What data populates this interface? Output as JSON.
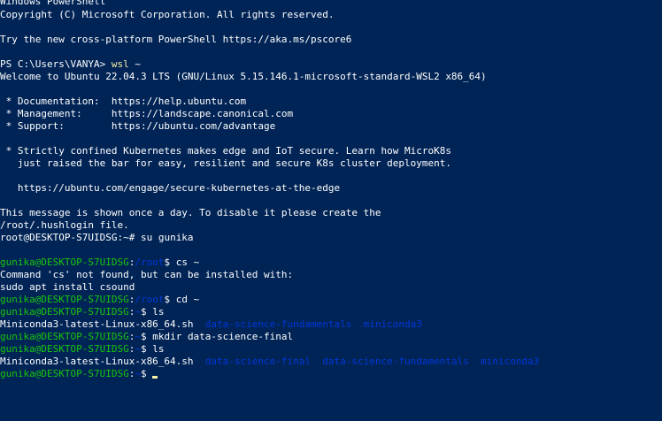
{
  "terminal": {
    "colors": {
      "background": "#012456",
      "text": "#ffffff",
      "user_host": "#16c60c",
      "path": "#0037da",
      "command_highlight": "#f9f1a5"
    },
    "header": {
      "title_line": "Windows PowerShell",
      "copyright": "Copyright (C) Microsoft Corporation. All rights reserved.",
      "tip": "Try the new cross-platform PowerShell https://aka.ms/pscore6"
    },
    "ps_prompt": {
      "prompt": "PS C:\\Users\\VANYA> ",
      "command": "wsl",
      "args": " ~"
    },
    "motd": {
      "welcome": "Welcome to Ubuntu 22.04.3 LTS (GNU/Linux 5.15.146.1-microsoft-standard-WSL2 x86_64)",
      "documentation": " * Documentation:  https://help.ubuntu.com",
      "management": " * Management:     https://landscape.canonical.com",
      "support": " * Support:        https://ubuntu.com/advantage",
      "k8s_line1": " * Strictly confined Kubernetes makes edge and IoT secure. Learn how MicroK8s",
      "k8s_line2": "   just raised the bar for easy, resilient and secure K8s cluster deployment.",
      "k8s_url": "   https://ubuntu.com/engage/secure-kubernetes-at-the-edge",
      "hush_line1": "This message is shown once a day. To disable it please create the",
      "hush_line2": "/root/.hushlogin file."
    },
    "root_prompt": {
      "prompt": "root@DESKTOP-S7UIDSG:~# ",
      "command": "su gunika"
    },
    "session": {
      "user_host": "gunika@DESKTOP-S7UIDSG",
      "sep": ":",
      "path_root": "/root",
      "path_home": "~",
      "dollar": "$ ",
      "cmd_cs": "cs ~",
      "err_line1": "Command 'cs' not found, but can be installed with:",
      "err_line2": "sudo apt install csound",
      "cmd_cd": "cd ~",
      "cmd_ls": "ls",
      "cmd_mkdir": "mkdir data-science-final",
      "ls1_file": "Miniconda3-latest-Linux-x86_64.sh",
      "ls1_dirs": "  data-science-fundamentals  miniconda3",
      "ls2_file": "Miniconda3-latest-Linux-x86_64.sh",
      "ls2_dirs": "  data-science-final  data-science-fundamentals  miniconda3"
    }
  }
}
